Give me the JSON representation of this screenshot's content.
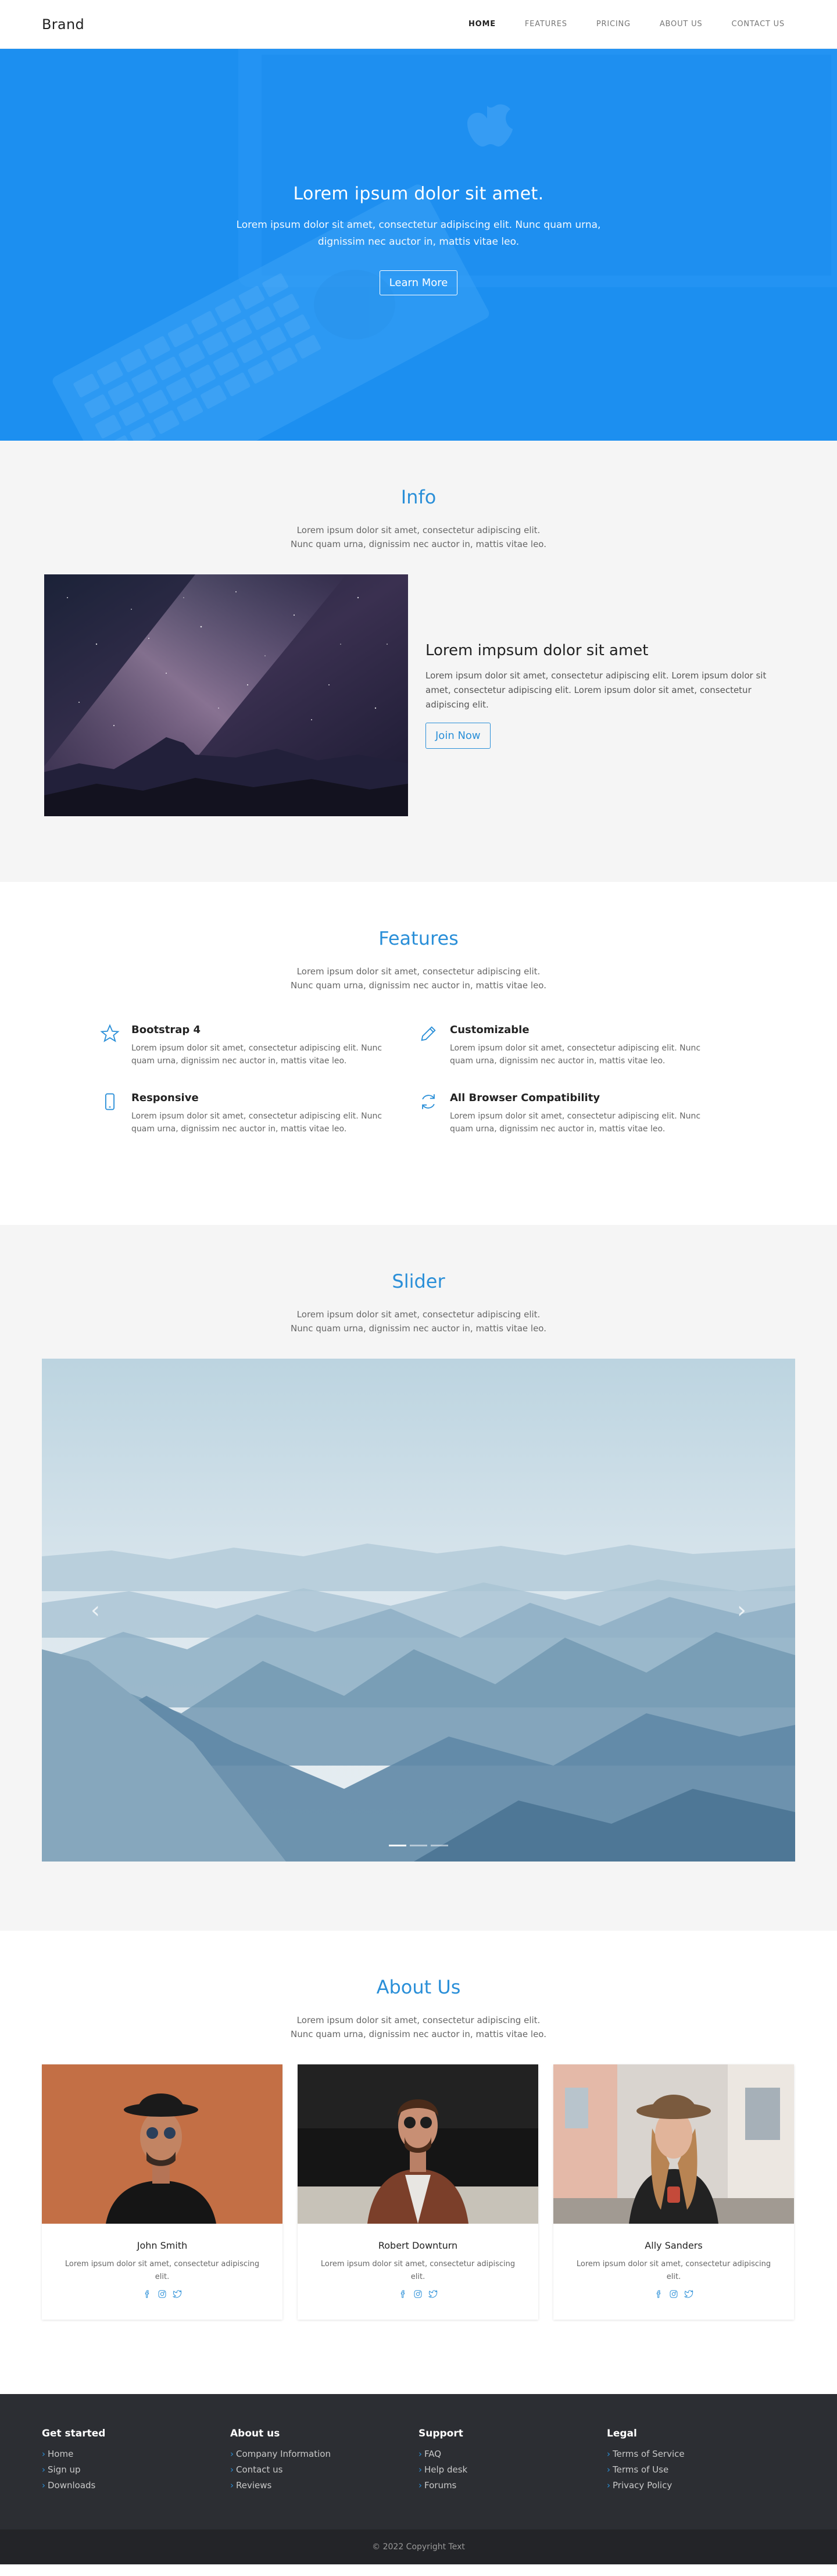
{
  "nav": {
    "brand": "Brand",
    "links": [
      "HOME",
      "FEATURES",
      "PRICING",
      "ABOUT US",
      "CONTACT US"
    ]
  },
  "hero": {
    "title": "Lorem ipsum dolor sit amet.",
    "text": "Lorem ipsum dolor sit amet, consectetur adipiscing elit. Nunc quam urna, dignissim nec auctor in, mattis vitae leo.",
    "button": "Learn More",
    "color": "#1f90ee"
  },
  "info": {
    "title": "Info",
    "subtitle": "Lorem ipsum dolor sit amet, consectetur adipiscing elit. Nunc quam urna, dignissim nec auctor in, mattis vitae leo.",
    "heading": "Lorem impsum dolor sit amet",
    "text": "Lorem ipsum dolor sit amet, consectetur adipiscing elit. Lorem ipsum dolor sit amet, consectetur adipiscing elit. Lorem ipsum dolor sit amet, consectetur adipiscing elit.",
    "button": "Join Now"
  },
  "features": {
    "title": "Features",
    "subtitle": "Lorem ipsum dolor sit amet, consectetur adipiscing elit. Nunc quam urna, dignissim nec auctor in, mattis vitae leo.",
    "items": [
      {
        "icon": "star-icon",
        "title": "Bootstrap 4",
        "text": "Lorem ipsum dolor sit amet, consectetur adipiscing elit. Nunc quam urna, dignissim nec auctor in, mattis vitae leo."
      },
      {
        "icon": "pencil-icon",
        "title": "Customizable",
        "text": "Lorem ipsum dolor sit amet, consectetur adipiscing elit. Nunc quam urna, dignissim nec auctor in, mattis vitae leo."
      },
      {
        "icon": "phone-icon",
        "title": "Responsive",
        "text": "Lorem ipsum dolor sit amet, consectetur adipiscing elit. Nunc quam urna, dignissim nec auctor in, mattis vitae leo."
      },
      {
        "icon": "refresh-icon",
        "title": "All Browser Compatibility",
        "text": "Lorem ipsum dolor sit amet, consectetur adipiscing elit. Nunc quam urna, dignissim nec auctor in, mattis vitae leo."
      }
    ]
  },
  "slider": {
    "title": "Slider",
    "subtitle": "Lorem ipsum dolor sit amet, consectetur adipiscing elit. Nunc quam urna, dignissim nec auctor in, mattis vitae leo.",
    "prev_icon": "‹",
    "next_icon": "›",
    "slides": 3,
    "active_slide": 1
  },
  "about": {
    "title": "About Us",
    "subtitle": "Lorem ipsum dolor sit amet, consectetur adipiscing elit. Nunc quam urna, dignissim nec auctor in, mattis vitae leo.",
    "team": [
      {
        "name": "John Smith",
        "text": "Lorem ipsum dolor sit amet, consectetur adipiscing elit."
      },
      {
        "name": "Robert Downturn",
        "text": "Lorem ipsum dolor sit amet, consectetur adipiscing elit."
      },
      {
        "name": "Ally Sanders",
        "text": "Lorem ipsum dolor sit amet, consectetur adipiscing elit."
      }
    ],
    "social_icons": [
      "facebook-icon",
      "instagram-icon",
      "twitter-icon"
    ]
  },
  "footer": {
    "columns": [
      {
        "title": "Get started",
        "links": [
          "Home",
          "Sign up",
          "Downloads"
        ]
      },
      {
        "title": "About us",
        "links": [
          "Company Information",
          "Contact us",
          "Reviews"
        ]
      },
      {
        "title": "Support",
        "links": [
          "FAQ",
          "Help desk",
          "Forums"
        ]
      },
      {
        "title": "Legal",
        "links": [
          "Terms of Service",
          "Terms of Use",
          "Privacy Policy"
        ]
      }
    ],
    "copyright": "© 2022 Copyright Text"
  },
  "colors": {
    "accent": "#2a8fd8",
    "footer": "#2c2e33"
  }
}
